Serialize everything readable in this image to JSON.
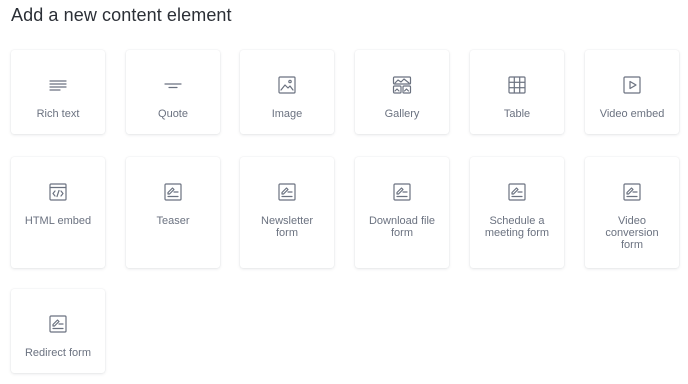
{
  "page": {
    "title": "Add a new content element"
  },
  "elements": [
    {
      "label": "Rich text",
      "icon": "rich-text-icon"
    },
    {
      "label": "Quote",
      "icon": "quote-icon"
    },
    {
      "label": "Image",
      "icon": "image-icon"
    },
    {
      "label": "Gallery",
      "icon": "gallery-icon"
    },
    {
      "label": "Table",
      "icon": "table-icon"
    },
    {
      "label": "Video embed",
      "icon": "video-embed-icon"
    },
    {
      "label": "HTML embed",
      "icon": "html-embed-icon"
    },
    {
      "label": "Teaser",
      "icon": "form-icon"
    },
    {
      "label": "Newsletter\nform",
      "icon": "form-icon"
    },
    {
      "label": "Download file\nform",
      "icon": "form-icon"
    },
    {
      "label": "Schedule a\nmeeting form",
      "icon": "form-icon"
    },
    {
      "label": "Video\nconversion\nform",
      "icon": "form-icon"
    },
    {
      "label": "Redirect form",
      "icon": "form-icon"
    }
  ],
  "colors": {
    "title": "#2b2f36",
    "label": "#6b7280",
    "icon": "#6b7280"
  }
}
